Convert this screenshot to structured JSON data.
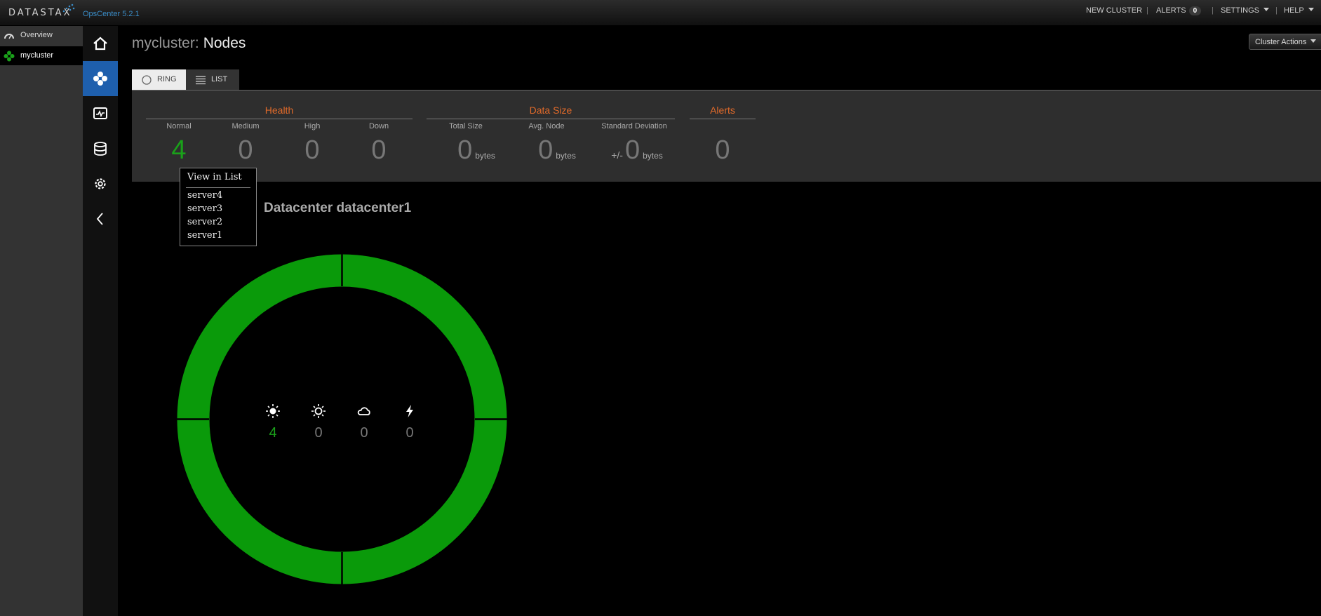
{
  "app": {
    "logo": "DATASTAX",
    "version": "OpsCenter 5.2.1"
  },
  "topnav": {
    "new_cluster": "NEW CLUSTER",
    "alerts": "ALERTS",
    "alerts_count": "0",
    "settings": "SETTINGS",
    "help": "HELP",
    "separator": "|"
  },
  "leftnav": {
    "items": [
      {
        "label": "Overview",
        "icon": "gauge-icon"
      },
      {
        "label": "mycluster",
        "icon": "cluster-icon"
      }
    ]
  },
  "rail": {
    "icons": [
      "home-icon",
      "nodes-icon",
      "dashboard-icon",
      "database-icon",
      "gear-icon",
      "chevron-left-icon"
    ]
  },
  "page": {
    "cluster": "mycluster:",
    "section": "Nodes",
    "cluster_actions": "Cluster Actions"
  },
  "tabs": {
    "ring": "RING",
    "list": "LIST"
  },
  "summary": {
    "health": {
      "title": "Health",
      "normal_label": "Normal",
      "normal": "4",
      "medium_label": "Medium",
      "medium": "0",
      "high_label": "High",
      "high": "0",
      "down_label": "Down",
      "down": "0"
    },
    "datasize": {
      "title": "Data Size",
      "total_label": "Total Size",
      "total": "0",
      "avg_label": "Avg. Node",
      "avg": "0",
      "std_label": "Standard Deviation",
      "std_prefix": "+/-",
      "std": "0",
      "unit": "bytes"
    },
    "alerts": {
      "title": "Alerts",
      "value": "0"
    }
  },
  "popup": {
    "header": "View in List",
    "servers": [
      "server4",
      "server3",
      "server2",
      "server1"
    ]
  },
  "datacenter": {
    "title": "Datacenter datacenter1",
    "ring_color": "#0a9a0a",
    "stats": [
      {
        "icon": "sun-icon",
        "value": "4"
      },
      {
        "icon": "sun-outline-icon",
        "value": "0"
      },
      {
        "icon": "cloud-icon",
        "value": "0"
      },
      {
        "icon": "lightning-icon",
        "value": "0"
      }
    ]
  },
  "colors": {
    "accent_blue": "#1e5fad",
    "health_orange": "#e06a2a",
    "normal_green": "#1aa01a"
  }
}
